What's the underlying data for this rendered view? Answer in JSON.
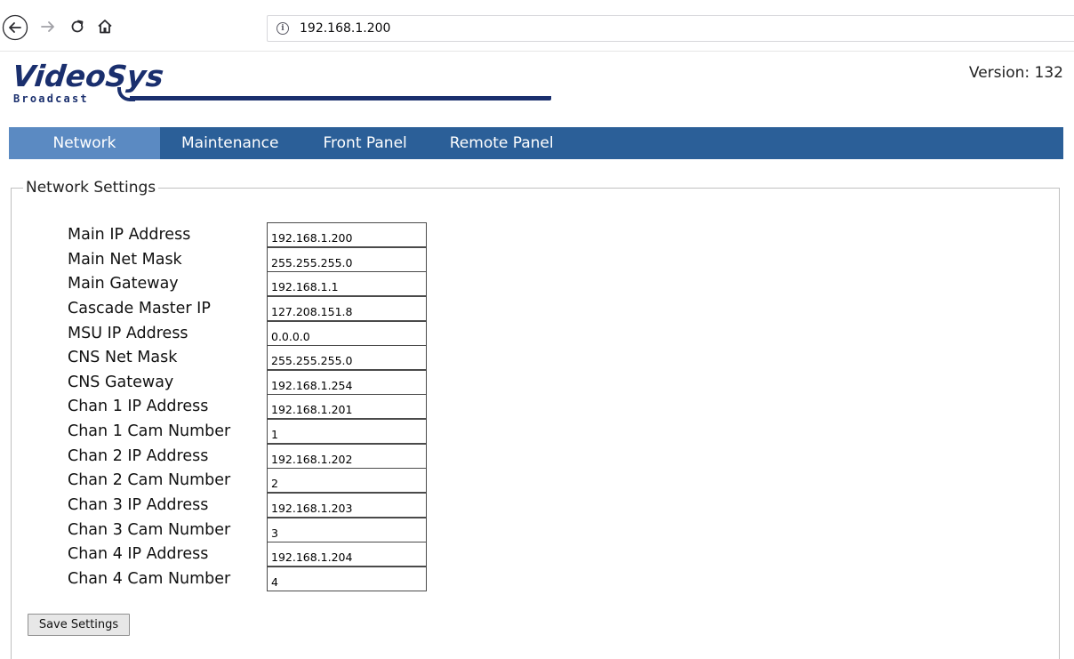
{
  "browser": {
    "url": "192.168.1.200",
    "icons": [
      "back-arrow-icon",
      "forward-arrow-icon",
      "reload-icon",
      "home-icon",
      "info-icon"
    ]
  },
  "header": {
    "logo_main": "VideoSys",
    "logo_sub": "Broadcast",
    "version": "Version: 132"
  },
  "menu": {
    "items": [
      {
        "label": "Network",
        "active": true
      },
      {
        "label": "Maintenance",
        "active": false
      },
      {
        "label": "Front Panel",
        "active": false
      },
      {
        "label": "Remote Panel",
        "active": false
      }
    ]
  },
  "settings": {
    "legend": "Network Settings",
    "fields": [
      {
        "label": "Main IP Address",
        "value": "192.168.1.200"
      },
      {
        "label": "Main Net Mask",
        "value": "255.255.255.0"
      },
      {
        "label": "Main Gateway",
        "value": "192.168.1.1"
      },
      {
        "label": "Cascade Master IP",
        "value": "127.208.151.8"
      },
      {
        "label": "MSU IP Address",
        "value": "0.0.0.0"
      },
      {
        "label": "CNS Net Mask",
        "value": "255.255.255.0"
      },
      {
        "label": "CNS Gateway",
        "value": "192.168.1.254"
      },
      {
        "label": "Chan 1 IP Address",
        "value": "192.168.1.201"
      },
      {
        "label": "Chan 1 Cam Number",
        "value": "1"
      },
      {
        "label": "Chan 2 IP Address",
        "value": "192.168.1.202"
      },
      {
        "label": "Chan 2 Cam Number",
        "value": "2"
      },
      {
        "label": "Chan 3 IP Address",
        "value": "192.168.1.203"
      },
      {
        "label": "Chan 3 Cam Number",
        "value": "3"
      },
      {
        "label": "Chan 4 IP Address",
        "value": "192.168.1.204"
      },
      {
        "label": "Chan 4 Cam Number",
        "value": "4"
      }
    ],
    "save_label": "Save Settings"
  },
  "colors": {
    "menu_bg": "#2b5f98",
    "menu_active_bg": "#5b8ac2",
    "logo": "#1a2f6e"
  }
}
